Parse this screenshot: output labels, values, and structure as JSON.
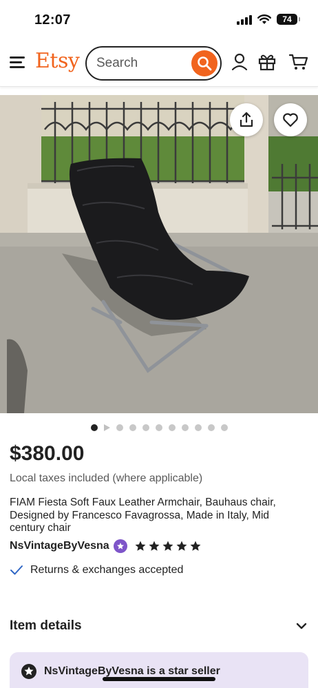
{
  "status_bar": {
    "time": "12:07",
    "battery": "74"
  },
  "header": {
    "logo": "Etsy",
    "search_placeholder": "Search"
  },
  "carousel": {
    "total": 11,
    "active_index": 0,
    "video_index": 1
  },
  "product": {
    "price": "$380.00",
    "taxes_note": "Local taxes included (where applicable)",
    "title": "FIAM Fiesta Soft Faux Leather Armchair, Bauhaus chair, Designed by Francesco Favagrossa, Made in Italy, Mid century chair",
    "seller_name": "NsVintageByVesna",
    "rating": 5,
    "returns_text": "Returns & exchanges accepted"
  },
  "item_details": {
    "title": "Item details"
  },
  "star_seller": {
    "text": "NsVintageByVesna is a star seller"
  },
  "colors": {
    "brand": "#f1641e",
    "star_badge": "#7e55c9",
    "card_bg": "#e9e3f5",
    "check": "#2f66c5"
  }
}
